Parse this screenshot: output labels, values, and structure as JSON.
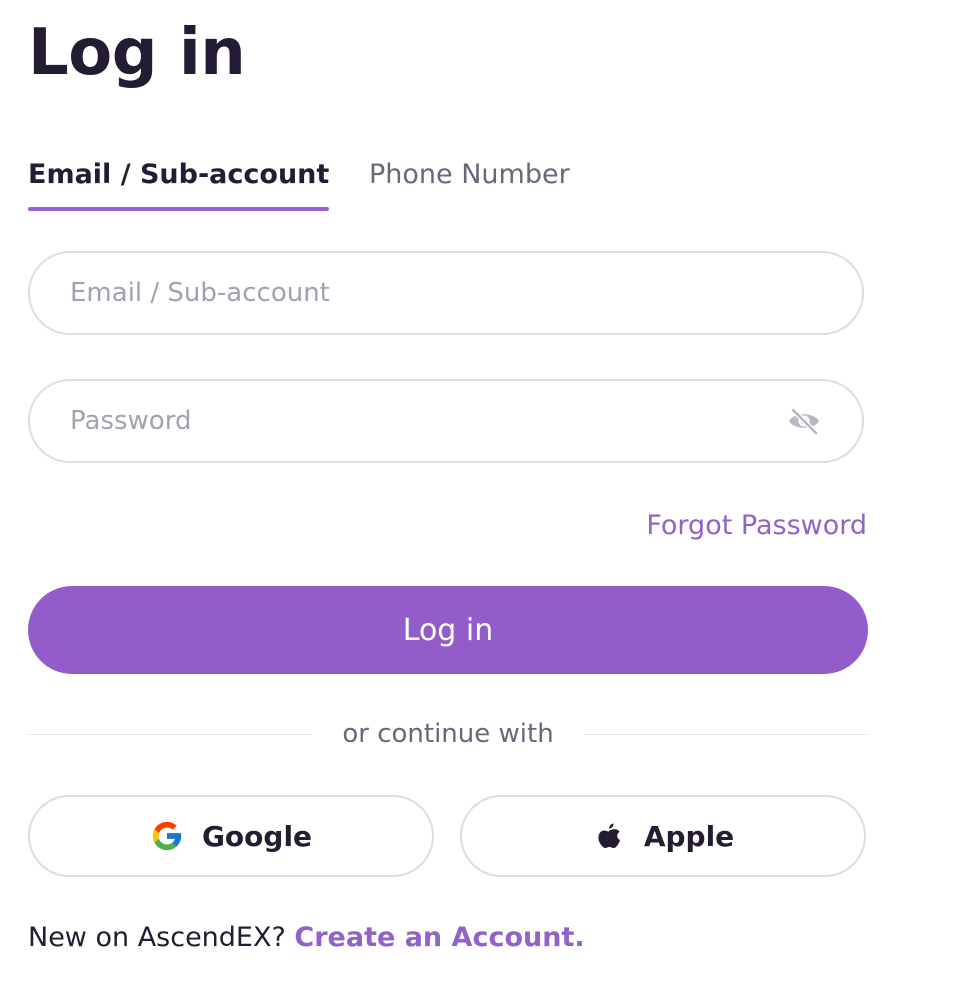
{
  "page": {
    "title": "Log in"
  },
  "tabs": [
    {
      "label": "Email / Sub-account",
      "active": true
    },
    {
      "label": "Phone Number",
      "active": false
    }
  ],
  "form": {
    "email": {
      "placeholder": "Email / Sub-account",
      "value": ""
    },
    "password": {
      "placeholder": "Password",
      "value": "",
      "toggle_icon": "eye-slash-icon"
    },
    "forgot_label": "Forgot Password",
    "submit_label": "Log in"
  },
  "divider": {
    "label": "or continue with"
  },
  "social": [
    {
      "label": "Google",
      "icon": "google-icon"
    },
    {
      "label": "Apple",
      "icon": "apple-icon"
    }
  ],
  "footer": {
    "prompt": "New on AscendEX?",
    "link_label": "Create an Account."
  },
  "colors": {
    "accent": "#925ccb",
    "link": "#9162c7",
    "text": "#231c33",
    "muted": "#6a6778",
    "border": "#dddce6"
  }
}
